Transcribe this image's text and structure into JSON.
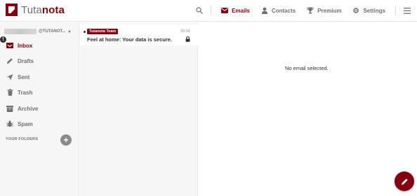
{
  "header": {
    "logo_text_light": "Tuta",
    "logo_text_bold": "nota",
    "nav": [
      {
        "label": "Emails",
        "icon": "envelope-icon"
      },
      {
        "label": "Contacts",
        "icon": "person-icon"
      },
      {
        "label": "Premium",
        "icon": "trophy-icon"
      },
      {
        "label": "Settings",
        "icon": "gear-icon"
      }
    ]
  },
  "sidebar": {
    "account_suffix": "@TUTANOT...",
    "account_chevron": "▾",
    "info_glyph": "!",
    "folders": [
      {
        "label": "Inbox",
        "icon": "inbox-icon"
      },
      {
        "label": "Drafts",
        "icon": "pencil-icon"
      },
      {
        "label": "Sent",
        "icon": "send-icon"
      },
      {
        "label": "Trash",
        "icon": "trash-icon"
      },
      {
        "label": "Archive",
        "icon": "archive-icon"
      },
      {
        "label": "Spam",
        "icon": "bug-icon"
      }
    ],
    "your_folders_label": "YOUR FOLDERS",
    "add_folder_glyph": "+"
  },
  "mail_list": {
    "items": [
      {
        "sender": "Tutanota Team",
        "time": "09:06",
        "subject": "Feel at home: Your data is secure.",
        "unread": true,
        "encrypted": true
      }
    ]
  },
  "viewer": {
    "empty_message": "No email selected."
  },
  "colors": {
    "accent": "#840010",
    "sidebar_bg": "#f6f6f6",
    "text_muted": "#707070"
  }
}
